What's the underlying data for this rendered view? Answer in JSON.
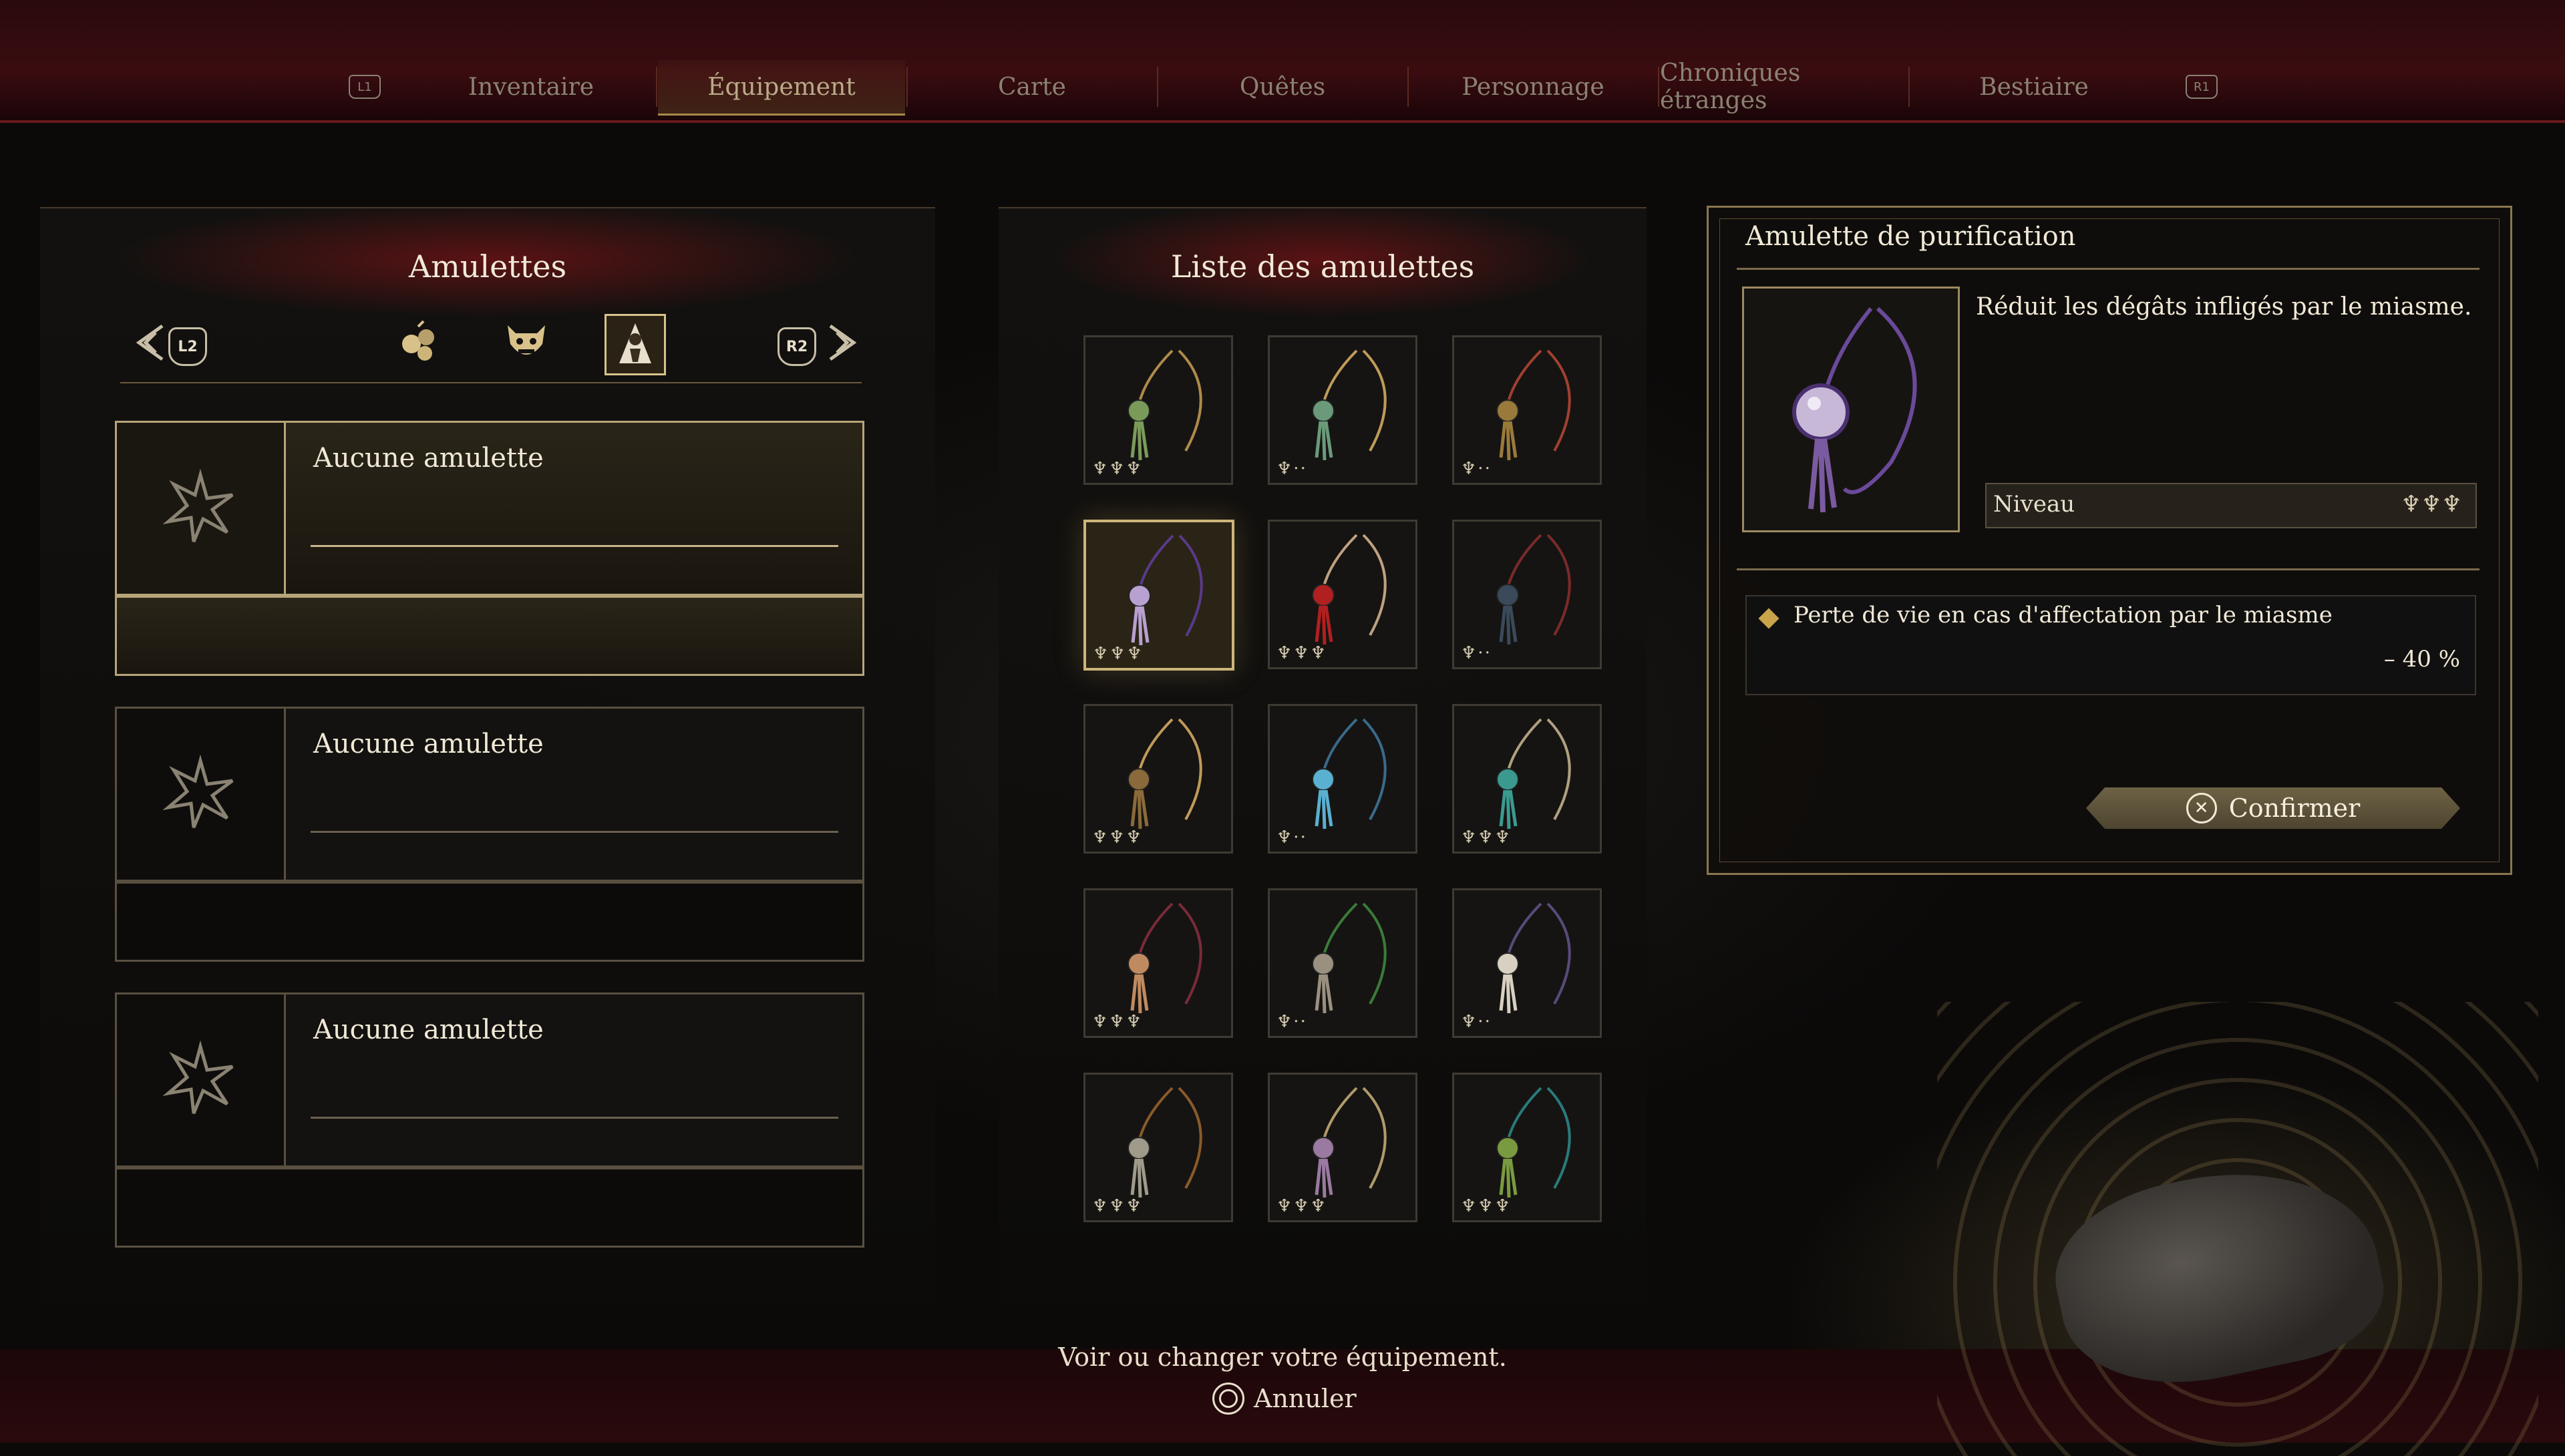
{
  "tabs": {
    "left_shoulder": "L1",
    "right_shoulder": "R1",
    "items": [
      {
        "label": "Inventaire",
        "active": false
      },
      {
        "label": "Équipement",
        "active": true
      },
      {
        "label": "Carte",
        "active": false
      },
      {
        "label": "Quêtes",
        "active": false
      },
      {
        "label": "Personnage",
        "active": false
      },
      {
        "label": "Chroniques étranges",
        "active": false
      },
      {
        "label": "Bestiaire",
        "active": false
      }
    ]
  },
  "left_panel": {
    "title": "Amulettes",
    "prev_button": "L2",
    "next_button": "R2",
    "categories": [
      {
        "icon": "berries-icon",
        "active": false
      },
      {
        "icon": "demon-mask-icon",
        "active": false
      },
      {
        "icon": "hooded-figure-icon",
        "active": true
      }
    ],
    "slots": [
      {
        "name": "Aucune amulette",
        "selected": true
      },
      {
        "name": "Aucune amulette",
        "selected": false
      },
      {
        "name": "Aucune amulette",
        "selected": false
      }
    ]
  },
  "middle_panel": {
    "title": "Liste des amulettes",
    "selected_index": 3,
    "items": [
      {
        "icon": "amulet-green-bead-icon",
        "color": "#7a9a5a",
        "cord": "#b08a4a",
        "level": 3
      },
      {
        "icon": "amulet-green-bell-icon",
        "color": "#6a9a7a",
        "cord": "#c09a5a",
        "level": 1
      },
      {
        "icon": "amulet-spiral-icon",
        "color": "#9a7a3a",
        "cord": "#a04030",
        "level": 1
      },
      {
        "icon": "amulet-purple-pearl-icon",
        "color": "#b8a0d0",
        "cord": "#5a3a8a",
        "level": 3
      },
      {
        "icon": "amulet-red-bead-icon",
        "color": "#b02020",
        "cord": "#c0a080",
        "level": 3
      },
      {
        "icon": "amulet-dark-feather-icon",
        "color": "#3a4a5a",
        "cord": "#7a2a2a",
        "level": 1
      },
      {
        "icon": "amulet-pouch-icon",
        "color": "#8a6a3a",
        "cord": "#c09a5a",
        "level": 3
      },
      {
        "icon": "amulet-blue-feather-icon",
        "color": "#5ab0d0",
        "cord": "#3a6a8a",
        "level": 1
      },
      {
        "icon": "amulet-teal-bead-icon",
        "color": "#3a9a90",
        "cord": "#b0a080",
        "level": 3
      },
      {
        "icon": "amulet-fur-tassel-icon",
        "color": "#c08a60",
        "cord": "#7a2a3a",
        "level": 3
      },
      {
        "icon": "amulet-grey-fur-icon",
        "color": "#9a9080",
        "cord": "#3a7a3a",
        "level": 1
      },
      {
        "icon": "amulet-white-fur-icon",
        "color": "#d8d0c0",
        "cord": "#5a4a7a",
        "level": 1
      },
      {
        "icon": "amulet-grey-feather-icon",
        "color": "#a09a8a",
        "cord": "#8a5a2a",
        "level": 3
      },
      {
        "icon": "amulet-violet-bell-icon",
        "color": "#9a7aa0",
        "cord": "#b09a6a",
        "level": 3
      },
      {
        "icon": "amulet-green-spiral-icon",
        "color": "#7a9a40",
        "cord": "#2a7a7a",
        "level": 3
      }
    ]
  },
  "detail": {
    "title": "Amulette de purification",
    "description": "Réduit les dégâts infligés par le miasme.",
    "level_label": "Niveau",
    "level": 3,
    "effect_label": "Perte de vie en cas d'affectation par le miasme",
    "effect_value": "– 40 %",
    "confirm_label": "Confirmer"
  },
  "footer": {
    "hint": "Voir ou changer votre équipement.",
    "cancel_label": "Annuler"
  }
}
